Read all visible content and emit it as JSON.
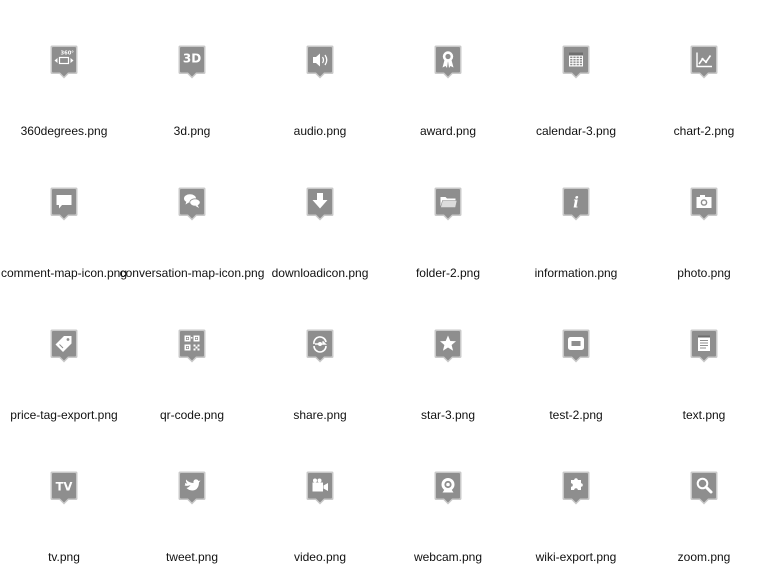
{
  "colors": {
    "marker_fill": "#8e8e8e",
    "marker_edge": "#c9c9c9",
    "glyph": "#ffffff",
    "label_text": "#111111",
    "background": "#ffffff"
  },
  "icons": [
    {
      "filename": "360degrees.png",
      "icon": "360-degrees-icon",
      "glyph_text": "360°"
    },
    {
      "filename": "3d.png",
      "icon": "3d-icon",
      "glyph_text": "3D"
    },
    {
      "filename": "audio.png",
      "icon": "audio-icon"
    },
    {
      "filename": "award.png",
      "icon": "award-icon"
    },
    {
      "filename": "calendar-3.png",
      "icon": "calendar-icon"
    },
    {
      "filename": "chart-2.png",
      "icon": "chart-icon"
    },
    {
      "filename": "comment-map-icon.png",
      "icon": "comment-icon"
    },
    {
      "filename": "conversation-map-icon.png",
      "icon": "conversation-icon"
    },
    {
      "filename": "downloadicon.png",
      "icon": "download-icon"
    },
    {
      "filename": "folder-2.png",
      "icon": "folder-icon"
    },
    {
      "filename": "information.png",
      "icon": "information-icon",
      "glyph_text": "i"
    },
    {
      "filename": "photo.png",
      "icon": "photo-icon"
    },
    {
      "filename": "price-tag-export.png",
      "icon": "price-tag-icon"
    },
    {
      "filename": "qr-code.png",
      "icon": "qr-code-icon"
    },
    {
      "filename": "share.png",
      "icon": "share-icon"
    },
    {
      "filename": "star-3.png",
      "icon": "star-icon"
    },
    {
      "filename": "test-2.png",
      "icon": "test-icon"
    },
    {
      "filename": "text.png",
      "icon": "text-icon"
    },
    {
      "filename": "tv.png",
      "icon": "tv-icon",
      "glyph_text": "TV"
    },
    {
      "filename": "tweet.png",
      "icon": "tweet-icon"
    },
    {
      "filename": "video.png",
      "icon": "video-icon"
    },
    {
      "filename": "webcam.png",
      "icon": "webcam-icon"
    },
    {
      "filename": "wiki-export.png",
      "icon": "wiki-export-icon"
    },
    {
      "filename": "zoom.png",
      "icon": "zoom-icon"
    }
  ]
}
